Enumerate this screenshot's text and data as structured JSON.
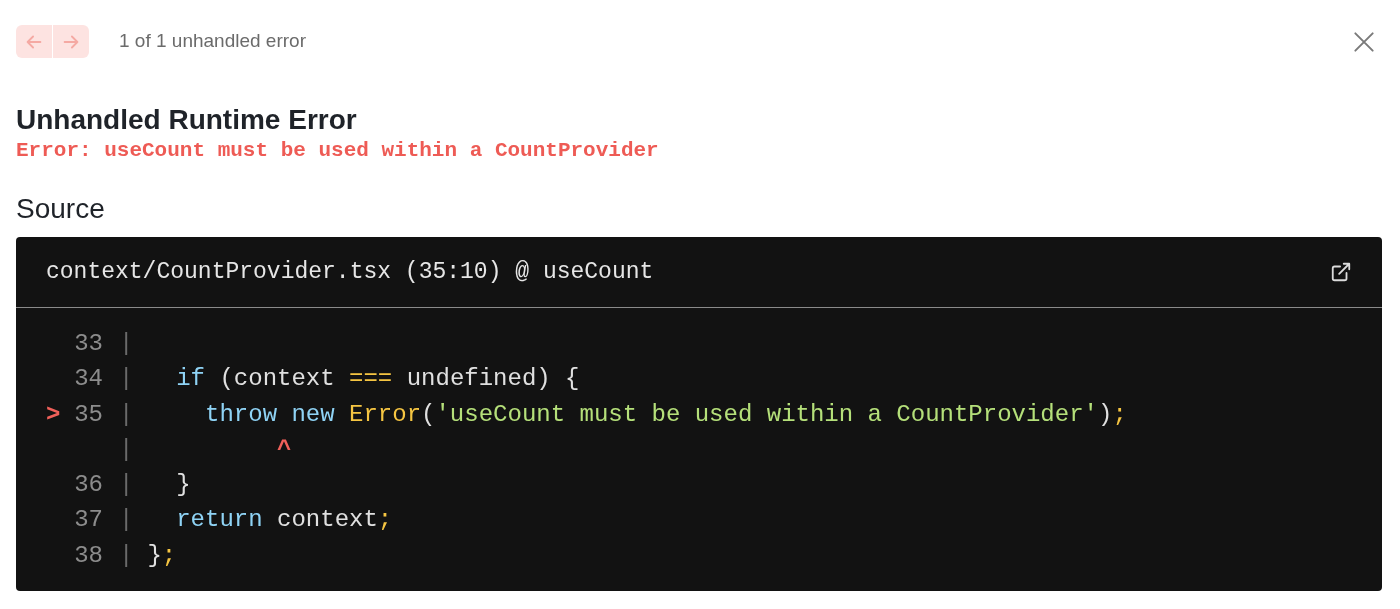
{
  "nav": {
    "buttons": [
      {
        "kind": "previous",
        "disabled": true
      },
      {
        "kind": "next",
        "disabled": true
      }
    ],
    "counter": "1 of 1 unhandled error"
  },
  "title": "Unhandled Runtime Error",
  "message": "Error: useCount must be used within a CountProvider",
  "source": {
    "heading": "Source",
    "file": "context/CountProvider.tsx (35:10) @ useCount",
    "lines": [
      {
        "number": "33",
        "separator": "|"
      },
      {
        "number": "34",
        "separator": "|",
        "tokens": [
          {
            "kind": "keyword",
            "text": "  if"
          },
          {
            "kind": "plain",
            "text": " (context "
          },
          {
            "kind": "operator",
            "text": "==="
          },
          {
            "kind": "plain",
            "text": " undefined) {"
          }
        ]
      },
      {
        "marker": ">",
        "number": "35",
        "separator": "|",
        "tokens": [
          {
            "kind": "keyword",
            "text": "    throw new"
          },
          {
            "kind": "class",
            "text": " Error"
          },
          {
            "kind": "plain",
            "text": "("
          },
          {
            "kind": "string",
            "text": "'useCount must be used within a CountProvider'"
          },
          {
            "kind": "plain",
            "text": ")"
          },
          {
            "kind": "operator",
            "text": ";"
          }
        ]
      },
      {
        "separator": "|",
        "tokens": [
          {
            "kind": "caret",
            "text": "         ^"
          }
        ]
      },
      {
        "number": "36",
        "separator": "|",
        "tokens": [
          {
            "kind": "plain",
            "text": "  }"
          }
        ]
      },
      {
        "number": "37",
        "separator": "|",
        "tokens": [
          {
            "kind": "keyword",
            "text": "  return"
          },
          {
            "kind": "plain",
            "text": " context"
          },
          {
            "kind": "operator",
            "text": ";"
          }
        ]
      },
      {
        "number": "38",
        "separator": "|",
        "tokens": [
          {
            "kind": "plain",
            "text": "}"
          },
          {
            "kind": "operator",
            "text": ";"
          }
        ]
      }
    ]
  }
}
